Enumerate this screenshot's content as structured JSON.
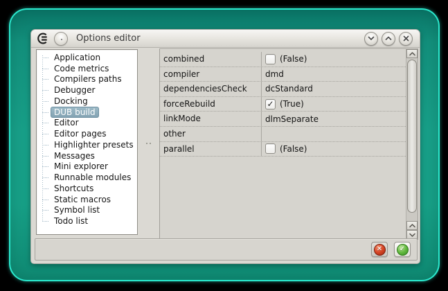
{
  "window": {
    "title": "Options editor",
    "controls": {
      "close_glyph": "✕"
    }
  },
  "sidebar": {
    "items": [
      {
        "label": "Application",
        "selected": false
      },
      {
        "label": "Code metrics",
        "selected": false
      },
      {
        "label": "Compilers paths",
        "selected": false
      },
      {
        "label": "Debugger",
        "selected": false
      },
      {
        "label": "Docking",
        "selected": false
      },
      {
        "label": "DUB build",
        "selected": true
      },
      {
        "label": "Editor",
        "selected": false
      },
      {
        "label": "Editor pages",
        "selected": false
      },
      {
        "label": "Highlighter presets",
        "selected": false
      },
      {
        "label": "Messages",
        "selected": false
      },
      {
        "label": "Mini explorer",
        "selected": false
      },
      {
        "label": "Runnable modules",
        "selected": false
      },
      {
        "label": "Shortcuts",
        "selected": false
      },
      {
        "label": "Static macros",
        "selected": false
      },
      {
        "label": "Symbol list",
        "selected": false
      },
      {
        "label": "Todo list",
        "selected": false
      }
    ]
  },
  "grid": {
    "rows": [
      {
        "name": "combined",
        "type": "checkbox",
        "check_glyph": "",
        "value": "(False)"
      },
      {
        "name": "compiler",
        "type": "text",
        "value": "dmd"
      },
      {
        "name": "dependenciesCheck",
        "type": "text",
        "value": "dcStandard"
      },
      {
        "name": "forceRebuild",
        "type": "checkbox",
        "check_glyph": "✓",
        "value": "(True)"
      },
      {
        "name": "linkMode",
        "type": "text",
        "value": "dlmSeparate"
      },
      {
        "name": "other",
        "type": "text",
        "value": ""
      },
      {
        "name": "parallel",
        "type": "checkbox",
        "check_glyph": "",
        "value": "(False)"
      }
    ]
  },
  "footer": {
    "cancel_glyph": "✕",
    "accept_glyph": "✓"
  },
  "colors": {
    "teal_background": "#18a089",
    "cyan_edge": "#2be8cd",
    "selection_blue": "#8fadbc",
    "cancel_red": "#d84727",
    "accept_green": "#63b93f"
  }
}
